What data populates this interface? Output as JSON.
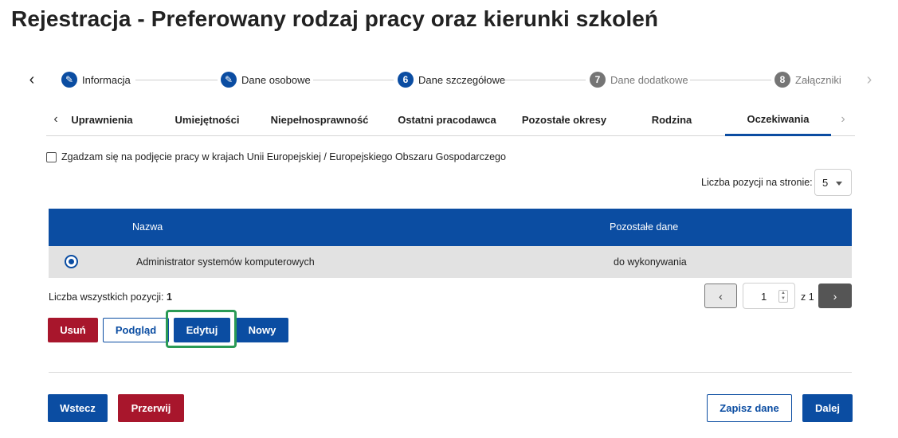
{
  "page_title": "Rejestracja - Preferowany rodzaj pracy oraz kierunki szkoleń",
  "stepper": {
    "steps": [
      {
        "badge": "✎",
        "label": "Informacja",
        "state": "done"
      },
      {
        "badge": "✎",
        "label": "Dane osobowe",
        "state": "done"
      },
      {
        "badge": "6",
        "label": "Dane szczegółowe",
        "state": "current"
      },
      {
        "badge": "7",
        "label": "Dane dodatkowe",
        "state": "pending"
      },
      {
        "badge": "8",
        "label": "Załączniki",
        "state": "pending"
      }
    ],
    "prev_icon": "‹",
    "next_icon": "›"
  },
  "tabs": {
    "items": [
      "Uprawnienia",
      "Umiejętności",
      "Niepełnosprawność",
      "Ostatni pracodawca",
      "Pozostałe okresy",
      "Rodzina",
      "Oczekiwania"
    ],
    "active": "Oczekiwania",
    "prev_icon": "‹",
    "next_icon": "›"
  },
  "eu_checkbox": {
    "label": "Zgadzam się na podjęcie pracy w krajach Unii Europejskiej / Europejskiego Obszaru Gospodarczego",
    "checked": false
  },
  "page_size": {
    "label": "Liczba pozycji na stronie:",
    "value": "5"
  },
  "table": {
    "columns": [
      "Nazwa",
      "Pozostałe dane"
    ],
    "rows": [
      {
        "selected": true,
        "name": "Administrator systemów komputerowych",
        "other": "do wykonywania"
      }
    ]
  },
  "total": {
    "label": "Liczba wszystkich pozycji:",
    "value": "1"
  },
  "pagination": {
    "current": "1",
    "of_label": "z 1",
    "prev_icon": "‹",
    "next_icon": "›",
    "spin_up": "▲",
    "spin_down": "▼"
  },
  "actions": {
    "delete": "Usuń",
    "preview": "Podgląd",
    "edit": "Edytuj",
    "new": "Nowy"
  },
  "footer": {
    "back": "Wstecz",
    "abort": "Przerwij",
    "save": "Zapisz dane",
    "next": "Dalej"
  },
  "colors": {
    "primary": "#0b4da2",
    "danger": "#a8162c",
    "highlight": "#2a9a55",
    "row": "#e2e2e2"
  }
}
